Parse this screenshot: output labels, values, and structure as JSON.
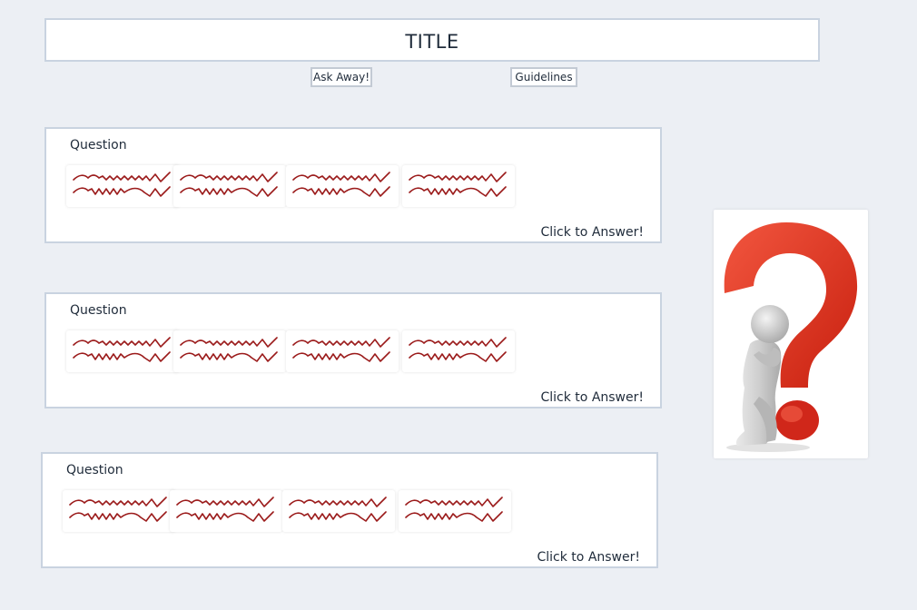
{
  "header": {
    "title": "TITLE"
  },
  "nav": {
    "ask_label": "Ask Away!",
    "guidelines_label": "Guidelines"
  },
  "questions": [
    {
      "label": "Question",
      "answer_label": "Click to Answer!"
    },
    {
      "label": "Question",
      "answer_label": "Click to Answer!"
    },
    {
      "label": "Question",
      "answer_label": "Click to Answer!"
    }
  ],
  "colors": {
    "background": "#eceff4",
    "card": "#ffffff",
    "border": "#c9d3e0",
    "scribble": "#9b1b1b",
    "question_mark": "#e8321f"
  },
  "icons": {
    "placeholder_text": "scribble-placeholder-icon",
    "thinking": "thinking-figure-question-mark-icon"
  }
}
